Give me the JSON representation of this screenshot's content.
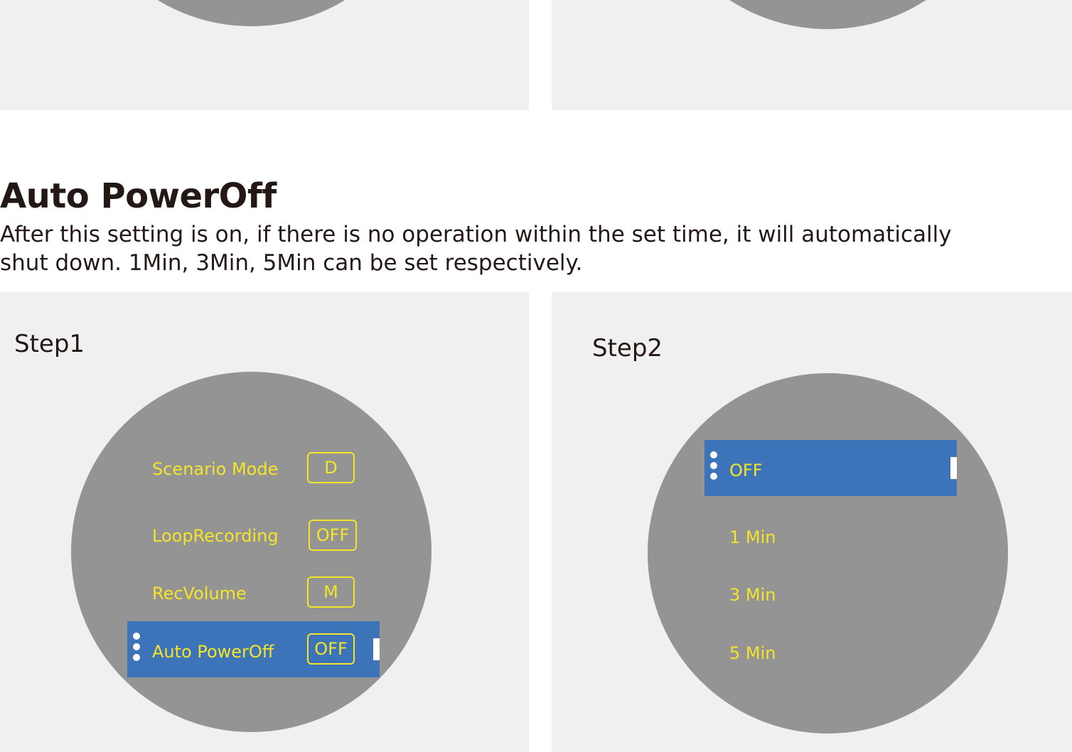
{
  "section": {
    "title": "Auto PowerOff",
    "description_line1": "After this setting is on, if there is no operation within the set time, it will automatically",
    "description_line2": "shut down. 1Min, 3Min, 5Min can be set respectively."
  },
  "step1": {
    "label": "Step1",
    "menu": [
      {
        "label": "Scenario Mode",
        "value": "D"
      },
      {
        "label": "LoopRecording",
        "value": "OFF"
      },
      {
        "label": "RecVolume",
        "value": "M"
      },
      {
        "label": "Auto PowerOff",
        "value": "OFF",
        "selected": true
      }
    ]
  },
  "step2": {
    "label": "Step2",
    "options": [
      {
        "label": "OFF",
        "selected": true
      },
      {
        "label": "1 Min"
      },
      {
        "label": "3 Min"
      },
      {
        "label": "5 Min"
      }
    ]
  },
  "colors": {
    "panel_bg": "#f0f0f0",
    "screen_bg": "#949494",
    "highlight": "#3d73b8",
    "menu_text": "#f5e529",
    "heading_text": "#231815"
  }
}
